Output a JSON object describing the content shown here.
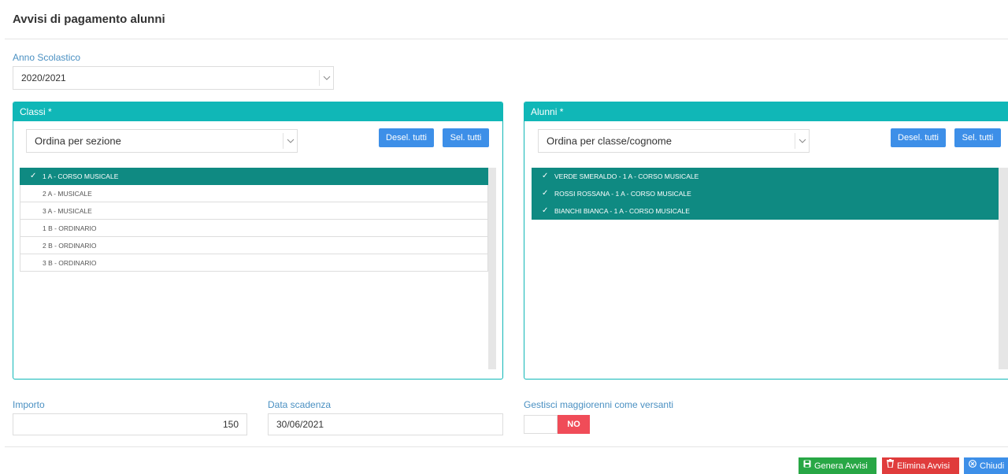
{
  "page": {
    "title": "Avvisi di pagamento alunni"
  },
  "anno": {
    "label": "Anno Scolastico",
    "value": "2020/2021"
  },
  "classi": {
    "header": "Classi *",
    "sort_value": "Ordina per sezione",
    "desel_label": "Desel. tutti",
    "sel_label": "Sel. tutti",
    "items": [
      {
        "label": "1 A - CORSO MUSICALE",
        "selected": true
      },
      {
        "label": "2 A - MUSICALE",
        "selected": false
      },
      {
        "label": "3 A - MUSICALE",
        "selected": false
      },
      {
        "label": "1 B - ORDINARIO",
        "selected": false
      },
      {
        "label": "2 B - ORDINARIO",
        "selected": false
      },
      {
        "label": "3 B - ORDINARIO",
        "selected": false
      }
    ]
  },
  "alunni": {
    "header": "Alunni *",
    "sort_value": "Ordina per classe/cognome",
    "desel_label": "Desel. tutti",
    "sel_label": "Sel. tutti",
    "items": [
      {
        "label": "VERDE SMERALDO - 1 A - CORSO MUSICALE",
        "selected": true
      },
      {
        "label": "ROSSI ROSSANA - 1 A - CORSO MUSICALE",
        "selected": true
      },
      {
        "label": "BIANCHI BIANCA - 1 A - CORSO MUSICALE",
        "selected": true
      }
    ]
  },
  "importo": {
    "label": "Importo",
    "value": "150"
  },
  "scadenza": {
    "label": "Data scadenza",
    "value": "30/06/2021"
  },
  "maggiorenni": {
    "label": "Gestisci maggiorenni come versanti",
    "toggle_value": "NO"
  },
  "actions": {
    "genera": "Genera Avvisi",
    "elimina": "Elimina Avvisi",
    "chiudi": "Chiudi"
  },
  "colors": {
    "teal": "#10b7b7",
    "selected_row": "#0f8a82",
    "blue_button": "#3d8fe8",
    "green_button": "#28a745",
    "red_button": "#e03c3c",
    "toggle_no": "#f04c58",
    "label_blue": "#4a90c2"
  },
  "check_icon": "✓"
}
